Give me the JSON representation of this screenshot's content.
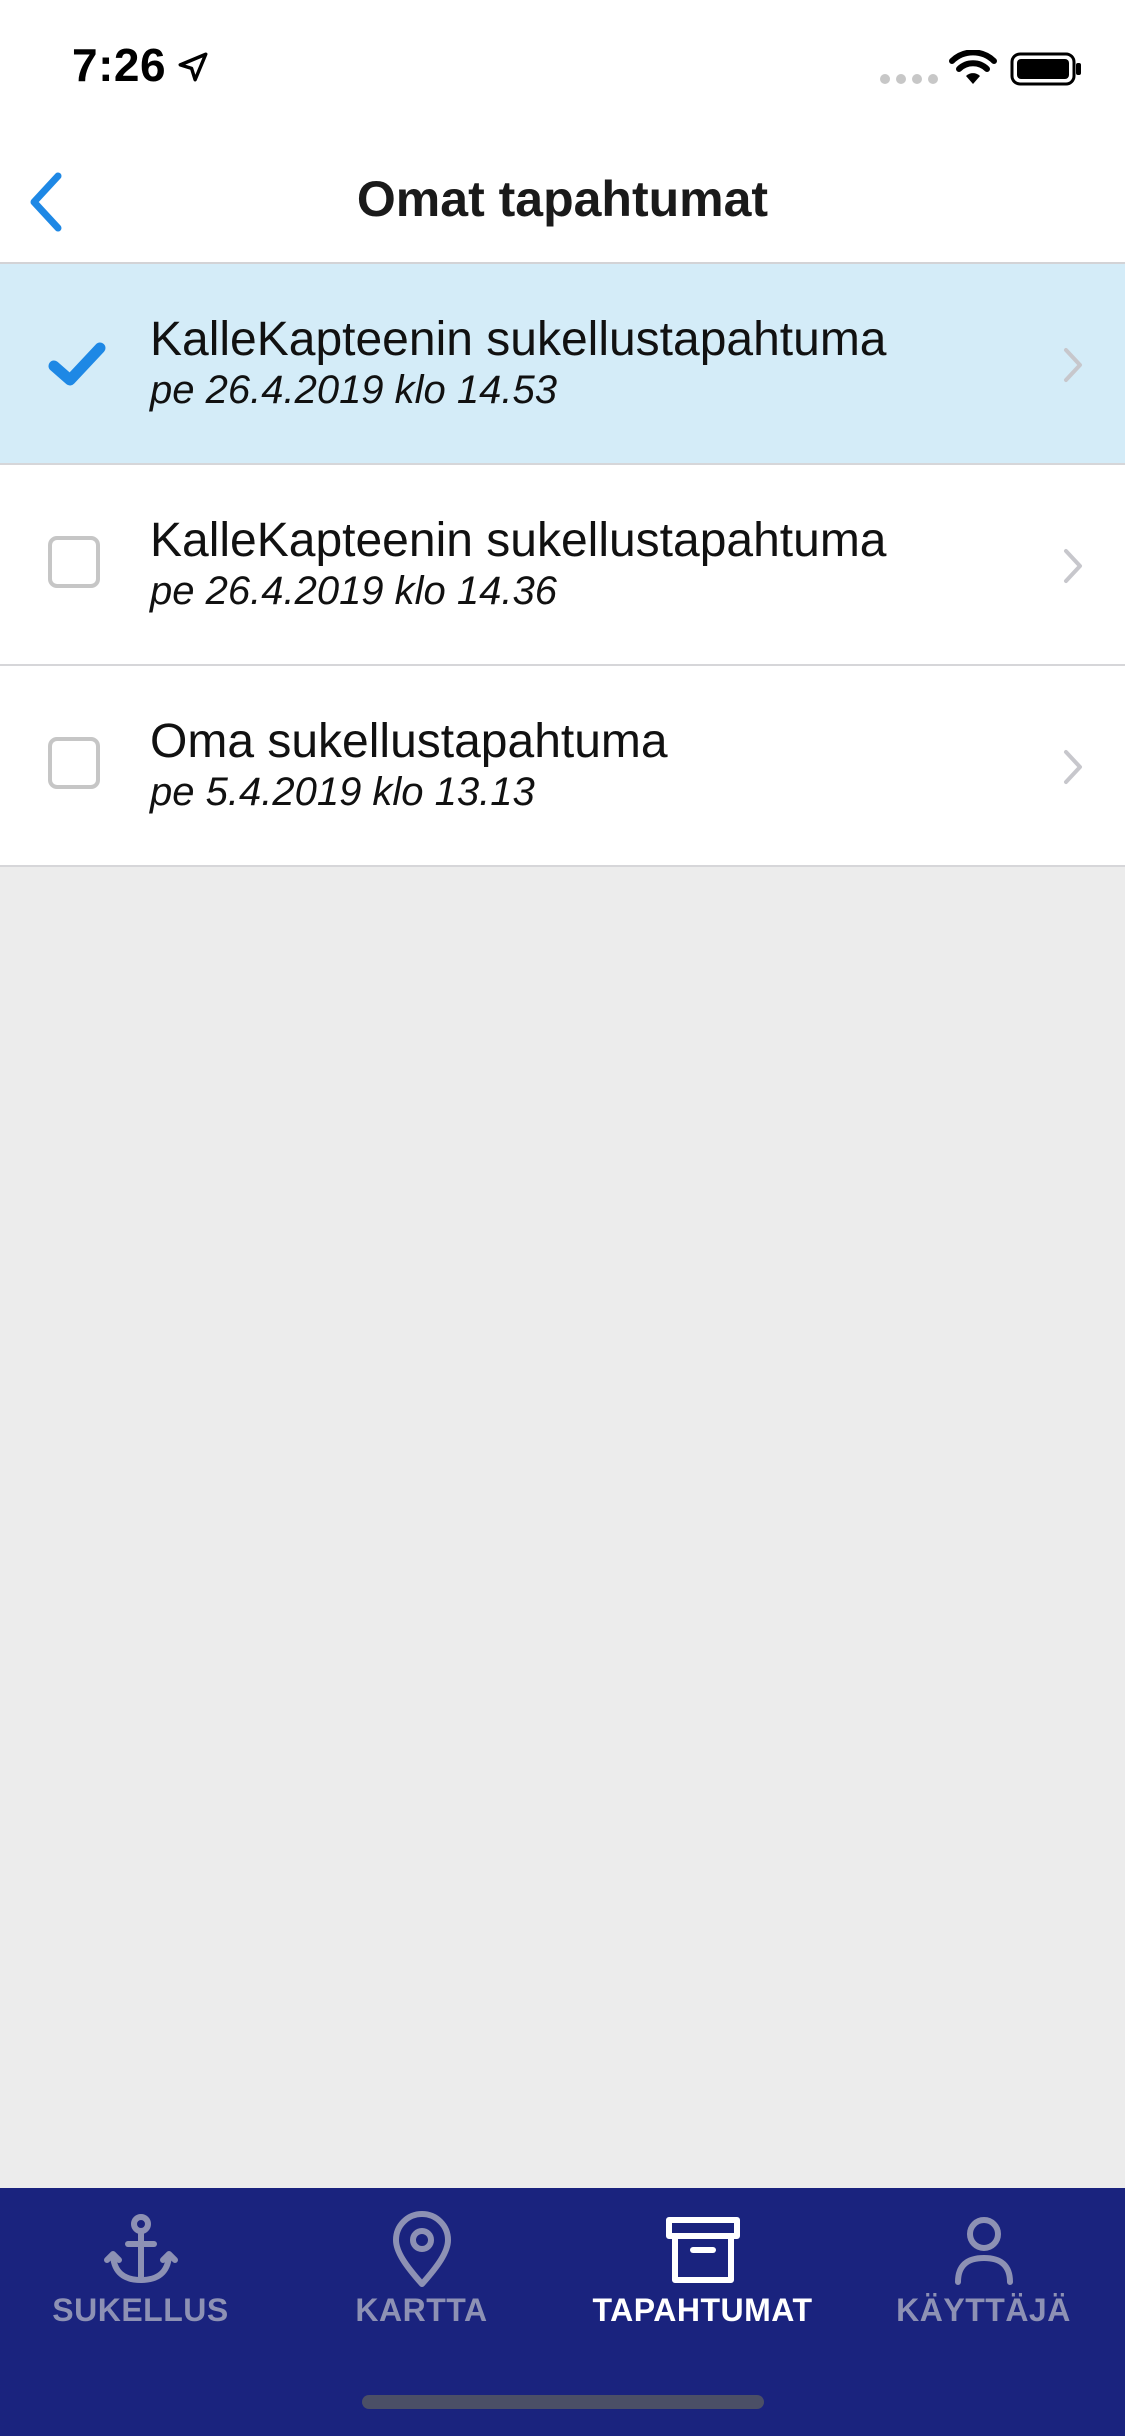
{
  "status_bar": {
    "time": "7:26",
    "icons": [
      "location-arrow-icon",
      "signal-dots-icon",
      "wifi-icon",
      "battery-icon"
    ]
  },
  "nav": {
    "title": "Omat tapahtumat",
    "back_icon": "chevron-left-icon"
  },
  "events": [
    {
      "title": "KalleKapteenin sukellustapahtuma",
      "date": "pe 26.4.2019 klo 14.53",
      "selected": true
    },
    {
      "title": "KalleKapteenin sukellustapahtuma",
      "date": "pe 26.4.2019 klo 14.36",
      "selected": false
    },
    {
      "title": "Oma sukellustapahtuma",
      "date": "pe 5.4.2019 klo 13.13",
      "selected": false
    }
  ],
  "tabs": [
    {
      "label": "SUKELLUS",
      "icon": "anchor-icon",
      "active": false
    },
    {
      "label": "KARTTA",
      "icon": "map-pin-icon",
      "active": false
    },
    {
      "label": "TAPAHTUMAT",
      "icon": "archive-box-icon",
      "active": true
    },
    {
      "label": "KÄYTTÄJÄ",
      "icon": "user-icon",
      "active": false
    }
  ],
  "colors": {
    "accent": "#1e88e5",
    "selected_row": "#d4ecf8",
    "tab_bar": "#1a237e",
    "tab_inactive": "#8d91b4",
    "tab_active": "#ffffff",
    "background": "#ececec"
  }
}
